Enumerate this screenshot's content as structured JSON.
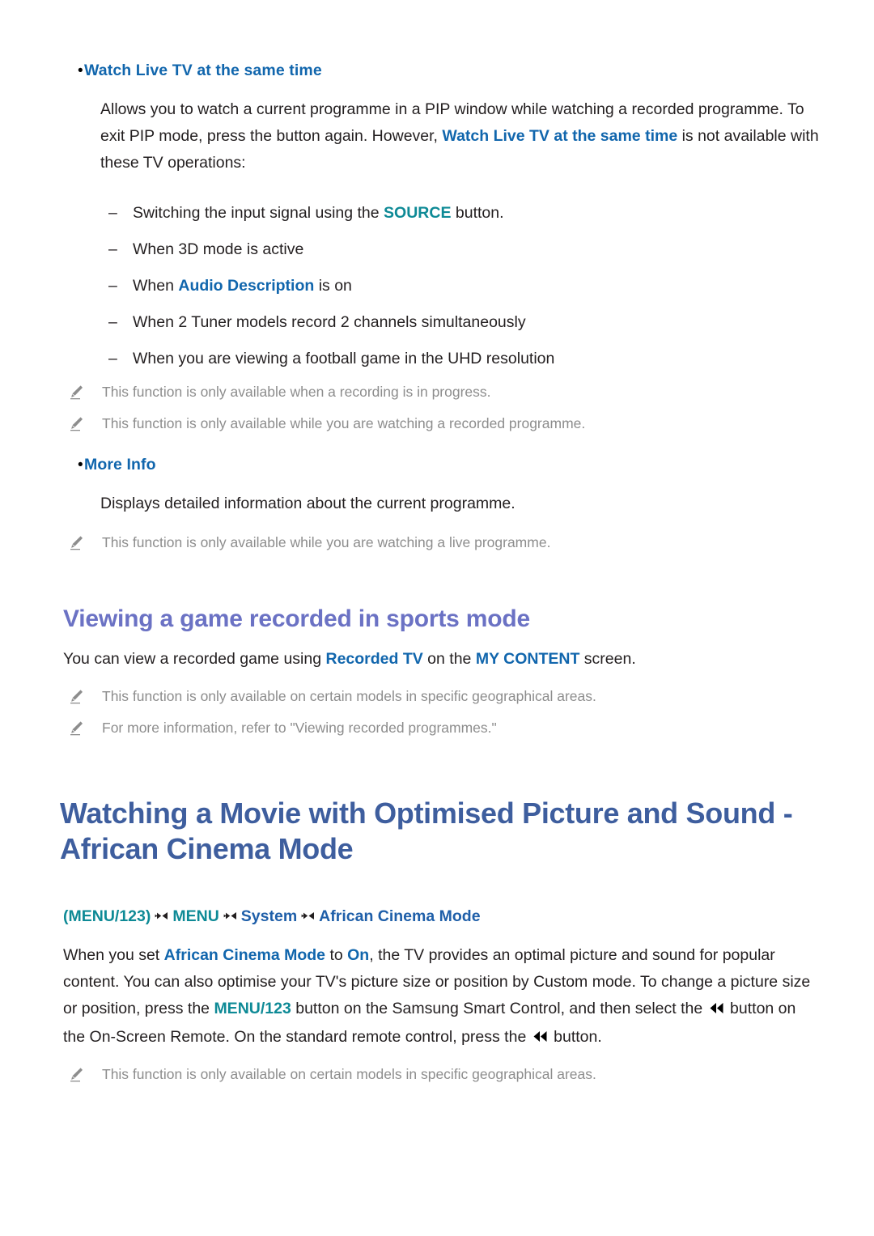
{
  "colors": {
    "link_blue": "#1166ad",
    "teal": "#0e8a96",
    "sub_heading": "#6b72c4",
    "main_heading": "#3e5e9e",
    "body_text": "#231f20",
    "note_text": "#8d8d8d",
    "page_background": "#ffffff"
  },
  "section_watch_live": {
    "bullet_mark": "•",
    "label": "Watch Live TV at the same time",
    "body": {
      "part1": "Allows you to watch a current programme in a PIP window while watching a recorded programme. To exit PIP mode, press the button again. However, ",
      "emphasis": "Watch Live TV at the same time",
      "part2": " is not available with these TV operations:"
    },
    "dash_mark": "–",
    "restrictions": [
      {
        "pre": "Switching the input signal using the ",
        "emphasis": "SOURCE",
        "emphasis_style": "teal",
        "post": " button."
      },
      {
        "pre": "When 3D mode is active",
        "emphasis": "",
        "emphasis_style": "",
        "post": ""
      },
      {
        "pre": "When ",
        "emphasis": "Audio Description",
        "emphasis_style": "blue",
        "post": " is on"
      },
      {
        "pre": "When 2 Tuner models record 2 channels simultaneously",
        "emphasis": "",
        "emphasis_style": "",
        "post": ""
      },
      {
        "pre": "When you are viewing a football game in the UHD resolution",
        "emphasis": "",
        "emphasis_style": "",
        "post": ""
      }
    ],
    "notes": [
      "This function is only available when a recording is in progress.",
      "This function is only available while you are watching a recorded programme."
    ]
  },
  "section_more_info": {
    "bullet_mark": "•",
    "label": "More Info",
    "body": "Displays detailed information about the current programme.",
    "notes": [
      "This function is only available while you are watching a live programme."
    ]
  },
  "section_sports_mode": {
    "heading": "Viewing a game recorded in sports mode",
    "body": {
      "part1": "You can view a recorded game using ",
      "emphasis1": "Recorded TV",
      "part2": " on the ",
      "emphasis2": "MY CONTENT",
      "part3": " screen."
    },
    "notes": [
      "This function is only available on certain models in specific geographical areas.",
      "For more information, refer to \"Viewing recorded programmes.\""
    ]
  },
  "section_african_cinema": {
    "heading": "Watching a Movie with Optimised Picture and Sound - African Cinema Mode",
    "breadcrumb": {
      "open_paren": "(",
      "menu123": "MENU/123",
      "close_paren": ")",
      "arrow_icon": "breadcrumb-arrow-icon",
      "items": [
        "MENU",
        "System",
        "African Cinema Mode"
      ]
    },
    "body": {
      "part1": "When you set ",
      "emphasis1": "African Cinema Mode",
      "part2": " to ",
      "emphasis2": "On",
      "part3": ", the TV provides an optimal picture and sound for popular content. You can also optimise your TV's picture size or position by Custom mode. To change a picture size or position, press the ",
      "emphasis3": "MENU/123",
      "part4": " button on the Samsung Smart Control, and then select the ",
      "rewind_icon": "rewind-icon",
      "part5": " button on the On-Screen Remote. On the standard remote control, press the ",
      "part6": " button."
    },
    "notes": [
      "This function is only available on certain models in specific geographical areas."
    ]
  }
}
